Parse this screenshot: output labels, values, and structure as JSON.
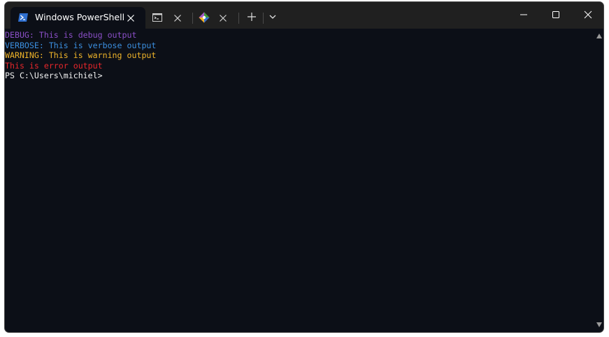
{
  "tabs": [
    {
      "title": "Windows PowerShell",
      "icon": "powershell-icon",
      "active": true
    },
    {
      "title": "",
      "icon": "command-prompt-icon",
      "active": false
    },
    {
      "title": "",
      "icon": "git-icon",
      "active": false
    }
  ],
  "titlebar": {
    "new_tab_icon": "plus-icon",
    "dropdown_icon": "chevron-down-icon"
  },
  "window_controls": [
    "minimize-icon",
    "maximize-icon",
    "close-icon"
  ],
  "terminal": {
    "lines": [
      {
        "text": "DEBUG: This is debug output",
        "color": "#8a4fc7"
      },
      {
        "text": "VERBOSE: This is verbose output",
        "color": "#3b8fe0"
      },
      {
        "text": "WARNING: This is warning output",
        "color": "#f0b429"
      },
      {
        "text": "This is error output",
        "color": "#e8272b"
      },
      {
        "text": "PS C:\\Users\\michiel>",
        "color": "#f2f2f2"
      }
    ]
  },
  "colors": {
    "terminal_bg": "#0c0f17",
    "titlebar_bg": "#202020",
    "powershell_blue": "#2f6fcf"
  }
}
